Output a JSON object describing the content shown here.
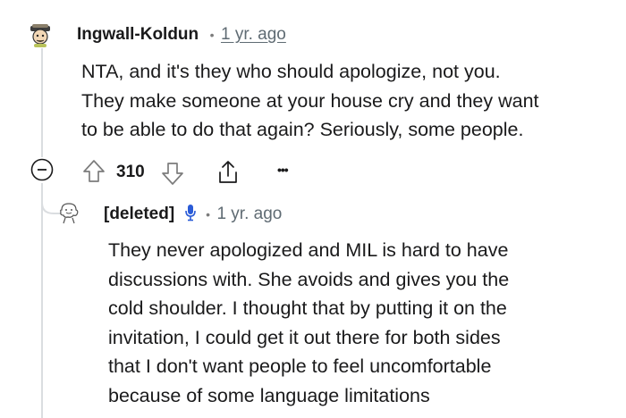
{
  "comments": [
    {
      "author": "Ingwall-Koldun",
      "separator": "•",
      "time": "1 yr. ago",
      "body": "NTA, and it's they who should apologize, not you.\nThey make someone at your house cry and they want\nto be able to do that again? Seriously, some people.",
      "actions": {
        "collapse_icon": "minus-circle-icon",
        "upvote_icon": "arrow-up-icon",
        "score": "310",
        "downvote_icon": "arrow-down-icon",
        "share_icon": "share-icon",
        "more": "•••"
      }
    },
    {
      "author": "[deleted]",
      "badge_icon": "microphone-icon",
      "separator": "•",
      "time": "1 yr. ago",
      "body": "They never apologized and MIL is hard to have\ndiscussions with. She avoids and gives you the\ncold shoulder. I thought that by putting it on the\ninvitation, I could get it out there for both sides\nthat I don't want people to feel uncomfortable\nbecause of some language limitations"
    }
  ],
  "colors": {
    "text": "#1a1a1b",
    "meta": "#5f6b73",
    "thread": "#dadde0",
    "mic": "#2a5bd7"
  }
}
